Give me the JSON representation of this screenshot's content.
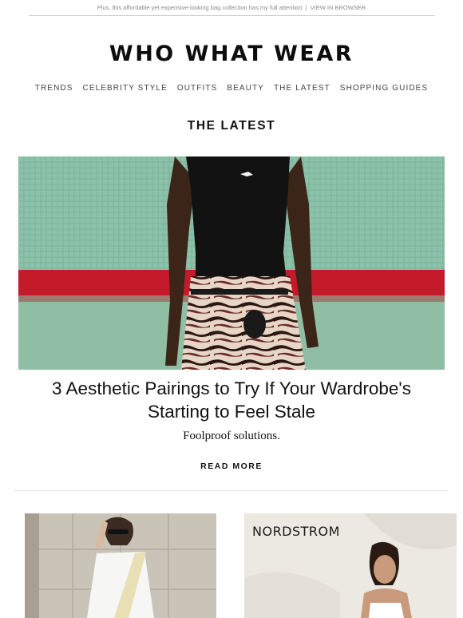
{
  "preheader": {
    "text": "Plus, this affordable yet expensive-looking bag collection has my full attention",
    "separator": "|",
    "link": "VIEW IN BROWSER"
  },
  "logo": "WHO WHAT WEAR",
  "nav": [
    "TRENDS",
    "CELEBRITY STYLE",
    "OUTFITS",
    "BEAUTY",
    "THE LATEST",
    "SHOPPING GUIDES"
  ],
  "section_title": "THE LATEST",
  "hero": {
    "headline": "3 Aesthetic Pairings to Try If Your Wardrobe's Starting to Feel Stale",
    "dek": "Foolproof solutions.",
    "cta": "READ MORE"
  },
  "cards": [
    {
      "image_brand": ""
    },
    {
      "image_brand": "NORDSTROM"
    }
  ],
  "colors": {
    "tile_green": "#7fb59b",
    "stripe_red": "#c8102e",
    "text": "#111111",
    "muted": "#8a8a8a"
  }
}
